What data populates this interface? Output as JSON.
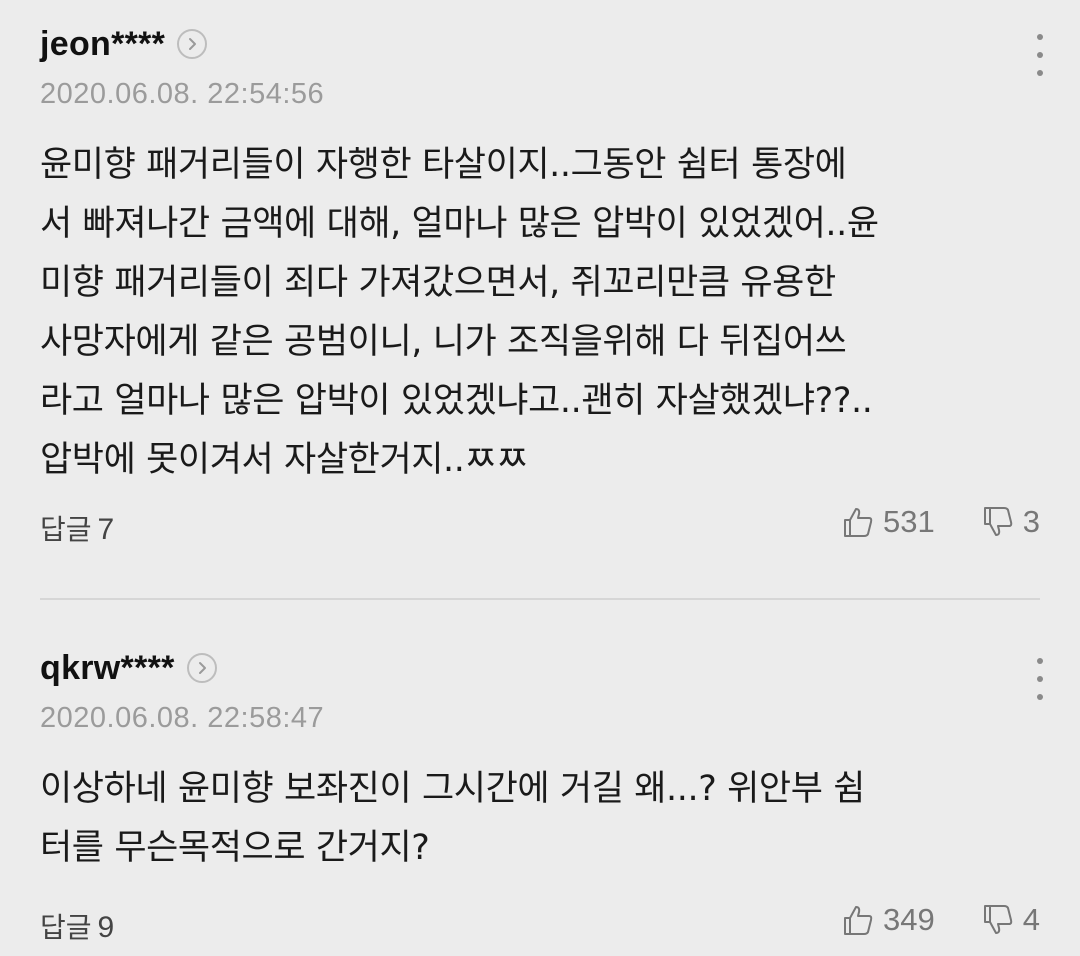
{
  "comments": [
    {
      "author": "jeon****",
      "date": "2020.06.08. 22:54:56",
      "body": "윤미향 패거리들이 자행한 타살이지..그동안 쉼터 통장에\n서 빠져나간 금액에 대해, 얼마나 많은 압박이 있었겠어..윤\n미향 패거리들이 죄다 가져갔으면서, 쥐꼬리만큼 유용한\n사망자에게 같은 공범이니, 니가 조직을위해 다 뒤집어쓰\n라고 얼마나 많은 압박이 있었겠냐고..괜히 자살했겠냐??..\n압박에 못이겨서 자살한거지..ㅉㅉ",
      "reply_label": "답글",
      "reply_count": "7",
      "likes": "531",
      "dislikes": "3"
    },
    {
      "author": "qkrw****",
      "date": "2020.06.08. 22:58:47",
      "body": "이상하네 윤미향 보좌진이 그시간에 거길 왜...? 위안부 쉼\n터를 무슨목적으로 간거지?",
      "reply_label": "답글",
      "reply_count": "9",
      "likes": "349",
      "dislikes": "4"
    }
  ],
  "icons": {
    "profile_link": "chevron-right-circle-icon",
    "more": "more-vertical-icon",
    "like": "thumbs-up-icon",
    "dislike": "thumbs-down-icon"
  },
  "colors": {
    "background": "#ececec",
    "author": "#111111",
    "date": "#9b9b9b",
    "icon": "#777777"
  }
}
